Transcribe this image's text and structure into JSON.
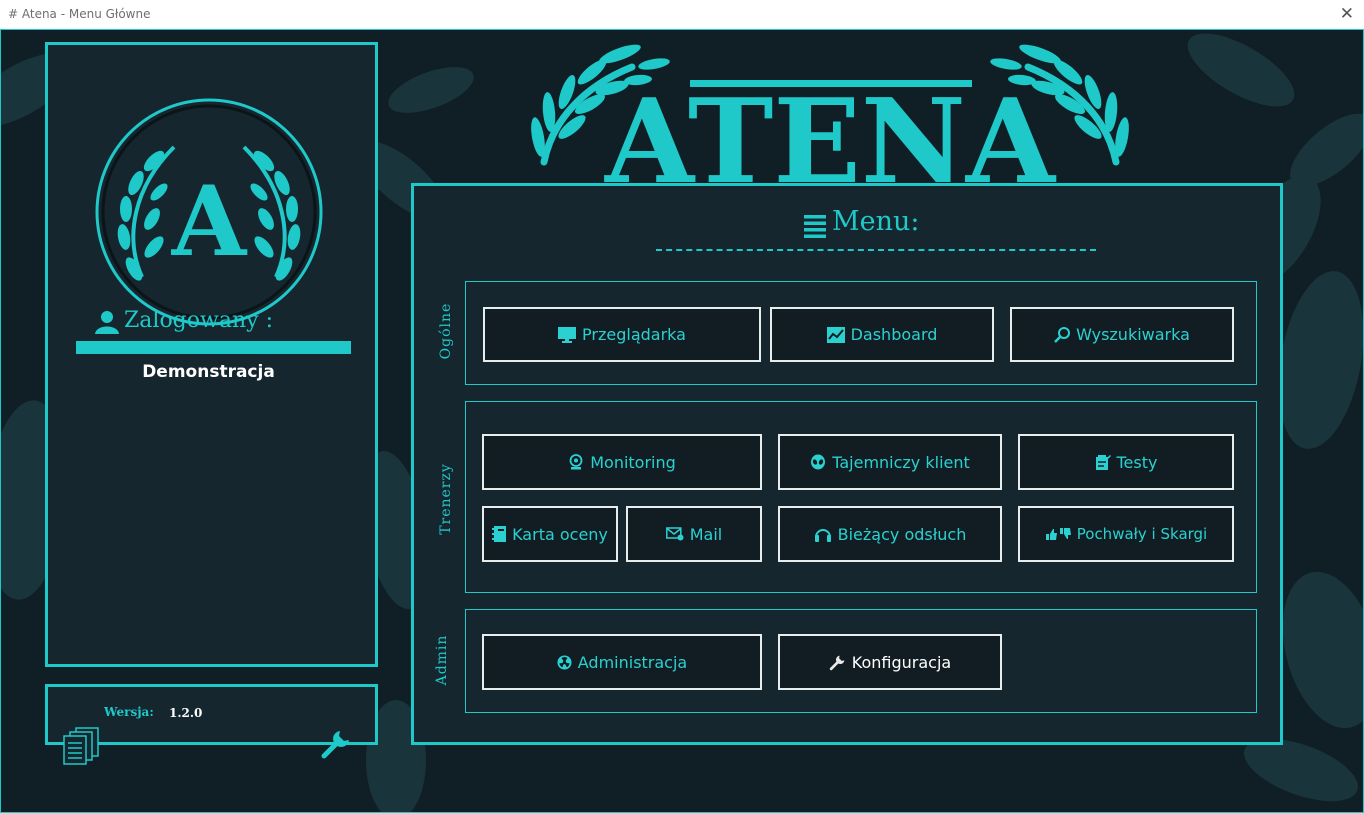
{
  "window": {
    "title": "# Atena - Menu Główne",
    "close_glyph": "✕"
  },
  "brand": {
    "name": "ATENA",
    "emblem_letter": "A",
    "accent_color": "#1fc9c9",
    "bg_color": "#0f1f25"
  },
  "user_panel": {
    "label": "Zalogowany",
    "colon": ":",
    "username": "Demonstracja"
  },
  "version_panel": {
    "label": "Wersja:",
    "value": "1.2.0"
  },
  "menu": {
    "title": "Menu:",
    "groups": [
      {
        "label": "Ogólne",
        "buttons": [
          {
            "label": "Przeglądarka",
            "icon": "monitor-icon"
          },
          {
            "label": "Dashboard",
            "icon": "chart-icon"
          },
          {
            "label": "Wyszukiwarka",
            "icon": "search-icon"
          }
        ]
      },
      {
        "label": "Trenerzy",
        "buttons": [
          {
            "label": "Monitoring",
            "icon": "webcam-icon"
          },
          {
            "label": "Tajemniczy klient",
            "icon": "alien-icon"
          },
          {
            "label": "Testy",
            "icon": "clipboard-icon"
          },
          {
            "label": "Karta oceny",
            "icon": "notebook-icon"
          },
          {
            "label": "Mail",
            "icon": "mail-icon"
          },
          {
            "label": "Bieżący odsłuch",
            "icon": "headphones-icon"
          },
          {
            "label": "Pochwały i Skargi",
            "icon": "thumbs-icon"
          }
        ]
      },
      {
        "label": "Admin",
        "buttons": [
          {
            "label": "Administracja",
            "icon": "radiation-icon"
          },
          {
            "label": "Konfiguracja",
            "icon": "wrench-icon"
          }
        ]
      }
    ]
  }
}
